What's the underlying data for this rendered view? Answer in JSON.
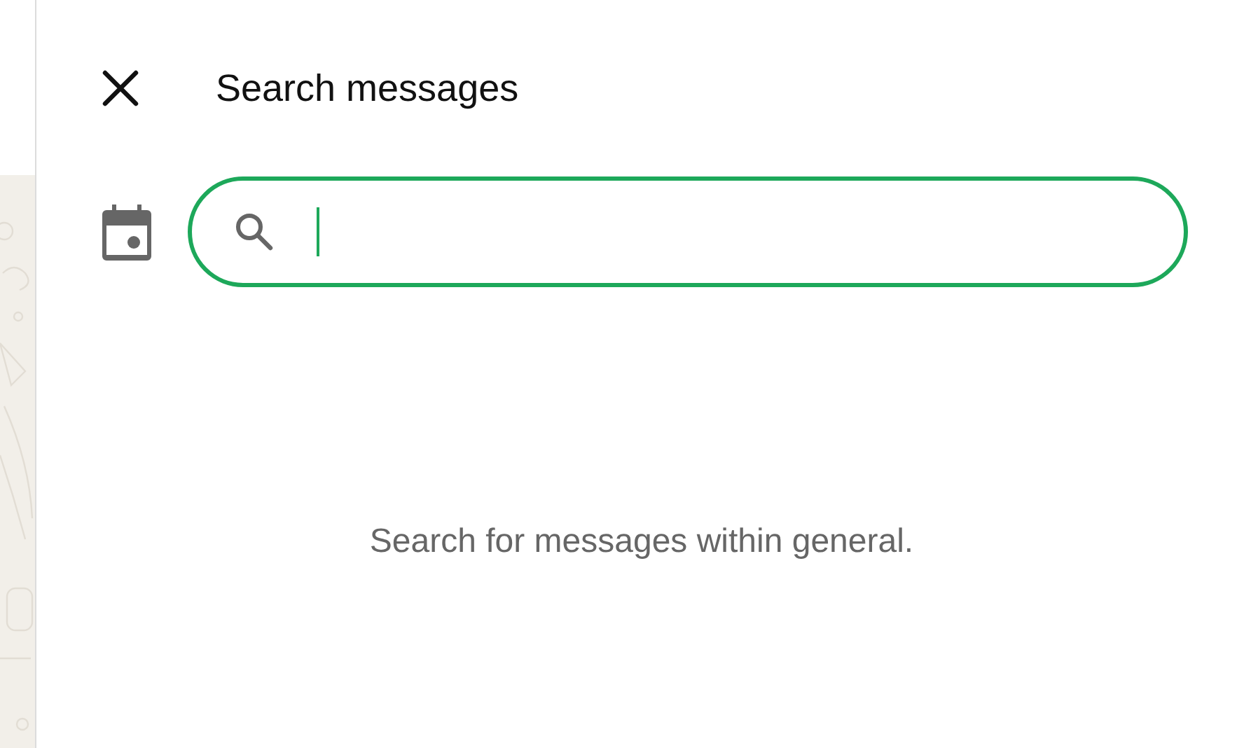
{
  "panel": {
    "title": "Search messages"
  },
  "search": {
    "focused": true
  },
  "empty_state": "Search for messages within general."
}
